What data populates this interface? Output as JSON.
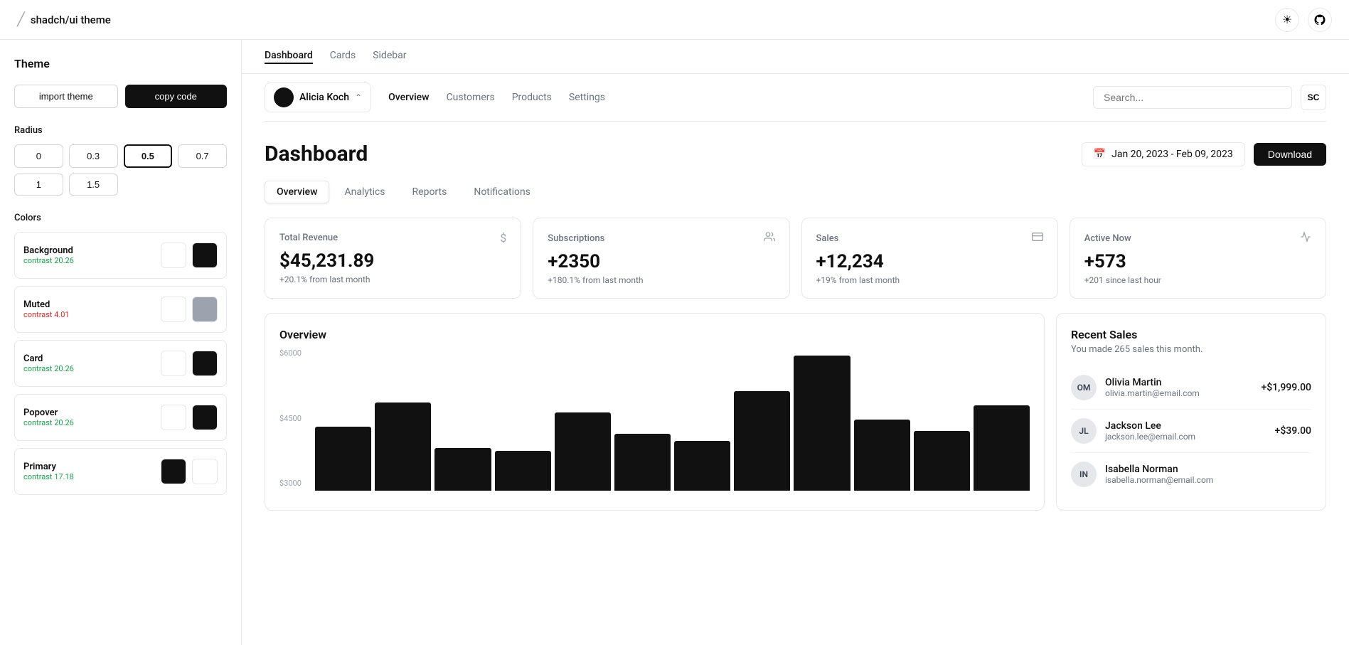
{
  "topbar": {
    "logo": "shadch/ui theme",
    "sun_icon": "☀",
    "github_icon": "⊙"
  },
  "left_panel": {
    "theme_label": "Theme",
    "import_btn": "import theme",
    "copy_btn": "copy code",
    "radius_label": "Radius",
    "radius_options": [
      {
        "value": "0",
        "active": false
      },
      {
        "value": "0.3",
        "active": false
      },
      {
        "value": "0.5",
        "active": true
      },
      {
        "value": "0.7",
        "active": false
      },
      {
        "value": "1",
        "active": false
      },
      {
        "value": "1.5",
        "active": false
      }
    ],
    "colors_label": "Colors",
    "color_rows": [
      {
        "label": "Background",
        "contrast_label": "contrast 20.26",
        "contrast_class": "contrast-green"
      },
      {
        "label": "Muted",
        "contrast_label": "contrast 4.01",
        "contrast_class": "contrast-red"
      },
      {
        "label": "Card",
        "contrast_label": "contrast 20.26",
        "contrast_class": "contrast-green"
      },
      {
        "label": "Popover",
        "contrast_label": "contrast 20.26",
        "contrast_class": "contrast-green"
      },
      {
        "label": "Primary",
        "contrast_label": "contrast 17.18",
        "contrast_class": "contrast-green"
      }
    ]
  },
  "page_tabs": [
    {
      "label": "Dashboard",
      "active": true
    },
    {
      "label": "Cards",
      "active": false
    },
    {
      "label": "Sidebar",
      "active": false
    }
  ],
  "nav": {
    "user_name": "Alicia Koch",
    "links": [
      {
        "label": "Overview",
        "active": true
      },
      {
        "label": "Customers",
        "active": false
      },
      {
        "label": "Products",
        "active": false
      },
      {
        "label": "Settings",
        "active": false
      }
    ],
    "search_placeholder": "Search...",
    "sc_label": "SC"
  },
  "dashboard": {
    "title": "Dashboard",
    "date_range": "Jan 20, 2023 - Feb 09, 2023",
    "download_btn": "Download",
    "sub_tabs": [
      {
        "label": "Overview",
        "active": true
      },
      {
        "label": "Analytics",
        "active": false
      },
      {
        "label": "Reports",
        "active": false
      },
      {
        "label": "Notifications",
        "active": false
      }
    ],
    "stats": [
      {
        "label": "Total Revenue",
        "icon": "$",
        "value": "$45,231.89",
        "sub": "+20.1% from last month"
      },
      {
        "label": "Subscriptions",
        "icon": "👥",
        "value": "+2350",
        "sub": "+180.1% from last month"
      },
      {
        "label": "Sales",
        "icon": "▤",
        "value": "+12,234",
        "sub": "+19% from last month"
      },
      {
        "label": "Active Now",
        "icon": "∿",
        "value": "+573",
        "sub": "+201 since last hour"
      }
    ],
    "overview_title": "Overview",
    "chart_y_labels": [
      "$6000",
      "$4500",
      "$3000"
    ],
    "chart_bars": [
      {
        "height_pct": 45
      },
      {
        "height_pct": 62
      },
      {
        "height_pct": 30
      },
      {
        "height_pct": 28
      },
      {
        "height_pct": 55
      },
      {
        "height_pct": 40
      },
      {
        "height_pct": 35
      },
      {
        "height_pct": 70
      },
      {
        "height_pct": 95
      },
      {
        "height_pct": 50
      },
      {
        "height_pct": 42
      },
      {
        "height_pct": 60
      }
    ],
    "recent_sales_title": "Recent Sales",
    "recent_sales_sub": "You made 265 sales this month.",
    "sales": [
      {
        "initials": "OM",
        "name": "Olivia Martin",
        "email": "olivia.martin@email.com",
        "amount": "+$1,999.00"
      },
      {
        "initials": "JL",
        "name": "Jackson Lee",
        "email": "jackson.lee@email.com",
        "amount": "+$39.00"
      },
      {
        "initials": "IN",
        "name": "Isabella Norman",
        "email": "isabella.norman@email.com",
        "amount": ""
      }
    ]
  }
}
